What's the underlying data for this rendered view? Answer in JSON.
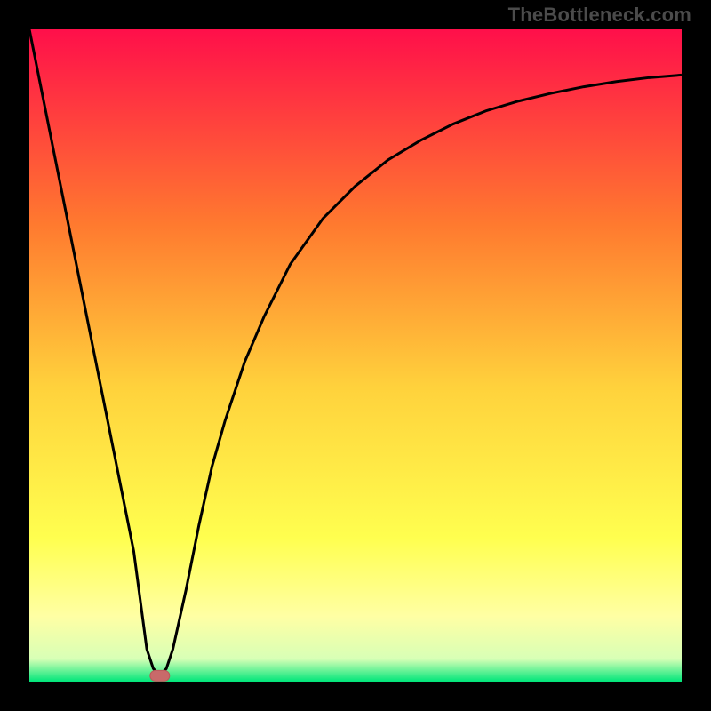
{
  "watermark": "TheBottleneck.com",
  "colors": {
    "black": "#000000",
    "grad_top": "#ff0f4a",
    "grad_mid_upper": "#ff9a2f",
    "grad_mid": "#ffd23c",
    "grad_yellow": "#ffff4f",
    "grad_pale_yellow": "#ffffa4",
    "grad_green": "#00e67a",
    "curve": "#000000",
    "marker_fill": "#c86a6a",
    "marker_stroke": "#b95a5a"
  },
  "chart_data": {
    "type": "line",
    "title": "",
    "xlabel": "",
    "ylabel": "",
    "xlim": [
      0,
      100
    ],
    "ylim": [
      0,
      100
    ],
    "x": [
      0,
      2,
      4,
      6,
      8,
      10,
      12,
      14,
      16,
      18,
      19,
      20,
      21,
      22,
      24,
      26,
      28,
      30,
      33,
      36,
      40,
      45,
      50,
      55,
      60,
      65,
      70,
      75,
      80,
      85,
      90,
      95,
      100
    ],
    "values": [
      100,
      90,
      80,
      70,
      60,
      50,
      40,
      30,
      20,
      5,
      2,
      1,
      2,
      5,
      14,
      24,
      33,
      40,
      49,
      56,
      64,
      71,
      76,
      80,
      83,
      85.5,
      87.5,
      89,
      90.2,
      91.2,
      92,
      92.6,
      93
    ],
    "series": [
      {
        "name": "curve",
        "x_ref": "x",
        "y_ref": "values"
      }
    ],
    "annotations": [
      {
        "type": "marker",
        "shape": "rounded-pill",
        "x": 20,
        "y": 0.9,
        "color": "#c86a6a"
      }
    ],
    "background_gradient": {
      "direction": "vertical",
      "stops": [
        {
          "offset": 0.0,
          "color": "#ff0f4a"
        },
        {
          "offset": 0.3,
          "color": "#ff7a2f"
        },
        {
          "offset": 0.55,
          "color": "#ffd23c"
        },
        {
          "offset": 0.78,
          "color": "#ffff4f"
        },
        {
          "offset": 0.9,
          "color": "#ffffa4"
        },
        {
          "offset": 0.965,
          "color": "#d8ffb6"
        },
        {
          "offset": 1.0,
          "color": "#00e67a"
        }
      ]
    },
    "legend": false,
    "grid": false
  }
}
